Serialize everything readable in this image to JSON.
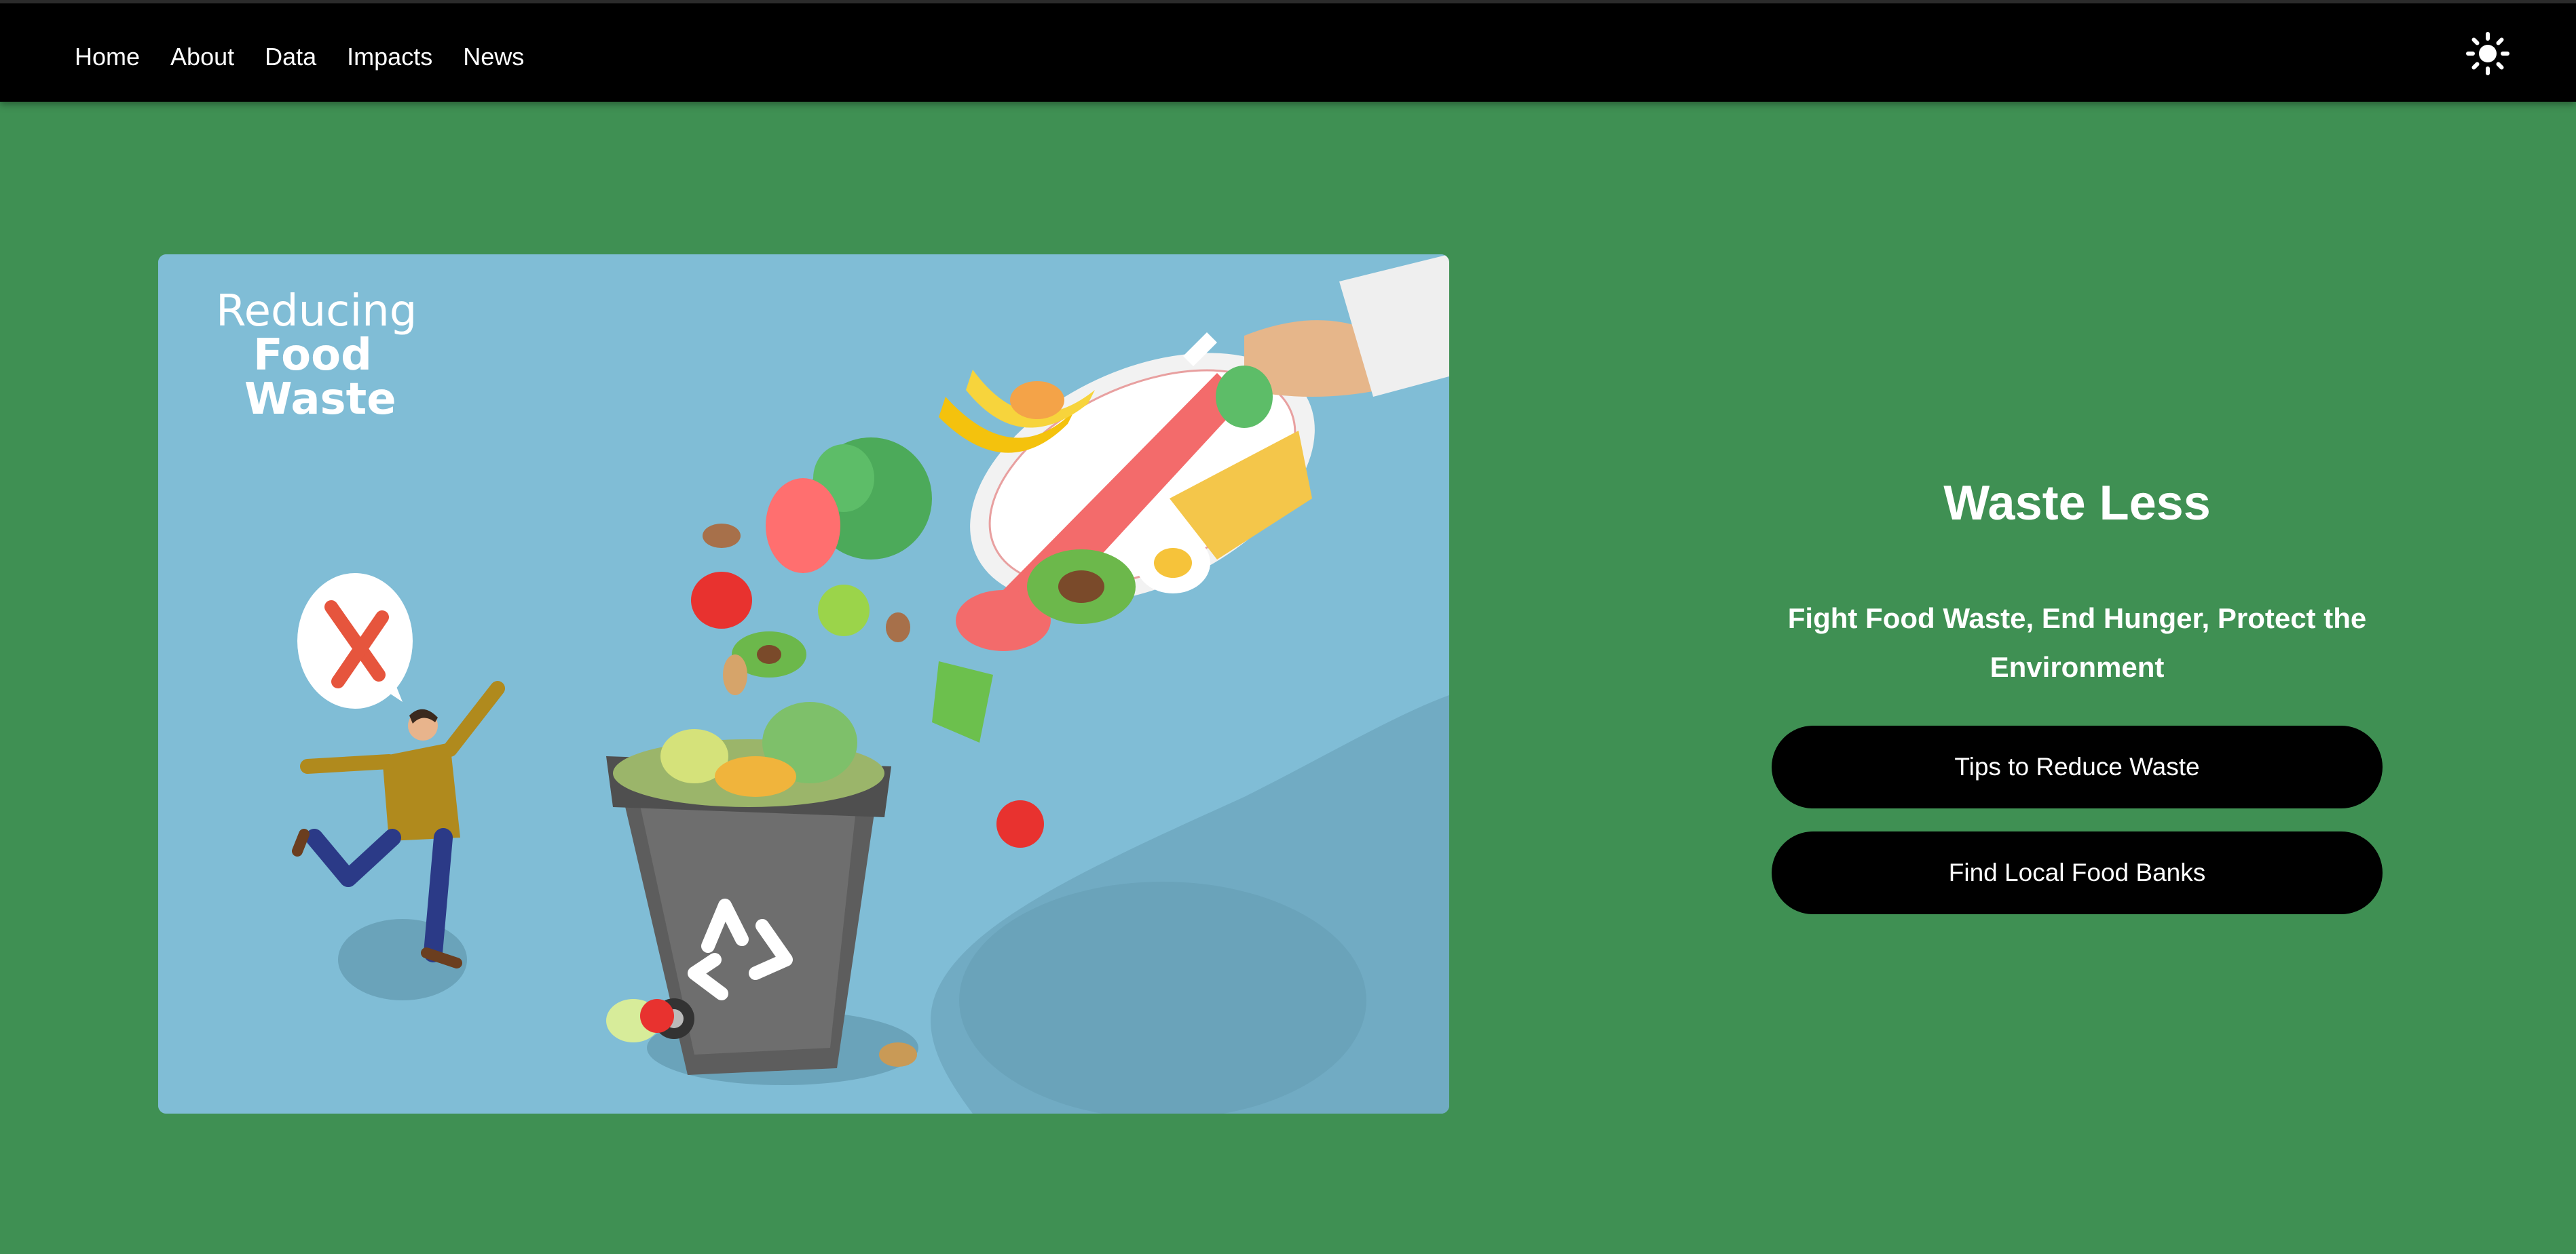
{
  "nav": {
    "items": [
      {
        "label": "Home"
      },
      {
        "label": "About"
      },
      {
        "label": "Data"
      },
      {
        "label": "Impacts"
      },
      {
        "label": "News"
      }
    ],
    "theme_toggle_icon": "sun-icon"
  },
  "hero": {
    "image": {
      "title_line1": "Reducing",
      "title_line2": "Food",
      "title_line3": "Waste"
    },
    "heading": "Waste Less",
    "tagline": "Fight Food Waste, End Hunger, Protect the Environment",
    "buttons": {
      "tips_label": "Tips to Reduce Waste",
      "food_banks_label": "Find Local Food Banks"
    }
  },
  "colors": {
    "background": "#3f9053",
    "nav_background": "#000000",
    "button_background": "#000000",
    "image_background": "#80bdd6"
  }
}
